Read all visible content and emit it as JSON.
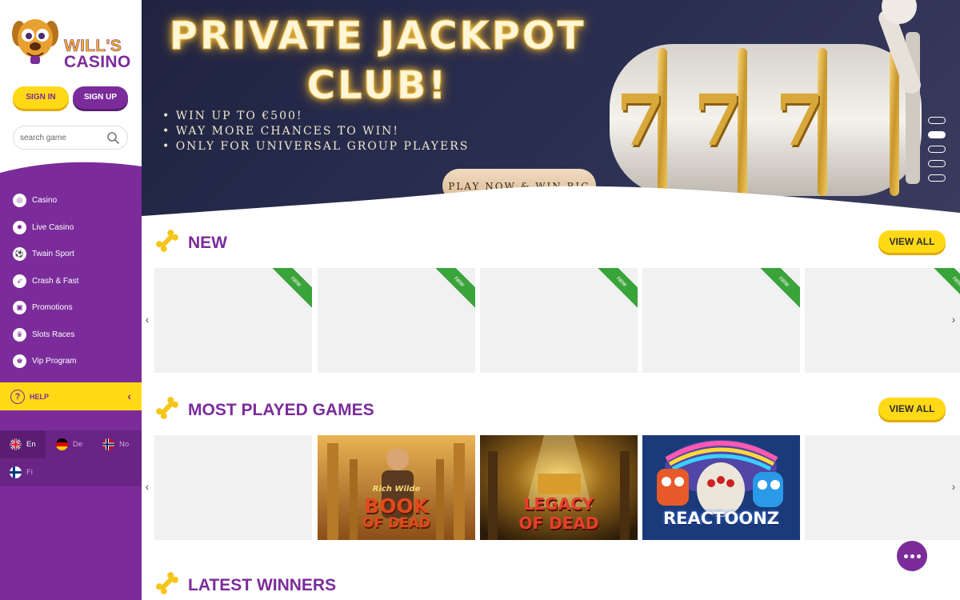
{
  "brand": {
    "line1": "WILL'S",
    "line2": "CASINO"
  },
  "auth": {
    "signin": "SIGN IN",
    "signup": "SIGN UP"
  },
  "search": {
    "placeholder": "search game"
  },
  "nav": {
    "items": [
      {
        "label": "Casino",
        "icon": "casino-icon"
      },
      {
        "label": "Live Casino",
        "icon": "live-casino-icon"
      },
      {
        "label": "Twain Sport",
        "icon": "sport-icon"
      },
      {
        "label": "Crash & Fast",
        "icon": "rocket-icon"
      },
      {
        "label": "Promotions",
        "icon": "gift-icon"
      },
      {
        "label": "Slots Races",
        "icon": "trophy-icon"
      },
      {
        "label": "Vip Program",
        "icon": "crown-icon"
      }
    ]
  },
  "help": {
    "label": "HELP"
  },
  "languages": [
    {
      "code": "En",
      "active": true
    },
    {
      "code": "De",
      "active": false
    },
    {
      "code": "No",
      "active": false
    },
    {
      "code": "Fi",
      "active": false
    }
  ],
  "banner": {
    "title_line1": "PRIVATE JACKPOT",
    "title_line2": "CLUB!",
    "bullets": [
      "• WIN UP TO €500!",
      "• WAY MORE CHANCES TO WIN!",
      "• ONLY FOR UNIVERSAL GROUP PLAYERS"
    ],
    "cta": "PLAY NOW & WIN BIG",
    "slot_symbols": [
      "7",
      "7",
      "7"
    ]
  },
  "sections": {
    "new": {
      "title": "NEW",
      "view_all": "VIEW ALL",
      "ribbon": "new"
    },
    "most_played": {
      "title": "MOST PLAYED GAMES",
      "view_all": "VIEW ALL",
      "games": [
        {
          "line1": "Rich Wilde",
          "line2": "BOOK",
          "line3": "OF DEAD"
        },
        {
          "line1": "",
          "line2": "LEGACY",
          "line3": "OF DEAD"
        },
        {
          "line1": "",
          "line2": "REACTOONZ",
          "line3": ""
        }
      ]
    },
    "latest_winners": {
      "title": "LATEST WINNERS"
    }
  },
  "colors": {
    "brand_purple": "#7b2c9a",
    "accent_yellow": "#ffd916",
    "ribbon_green": "#3aa33a"
  }
}
